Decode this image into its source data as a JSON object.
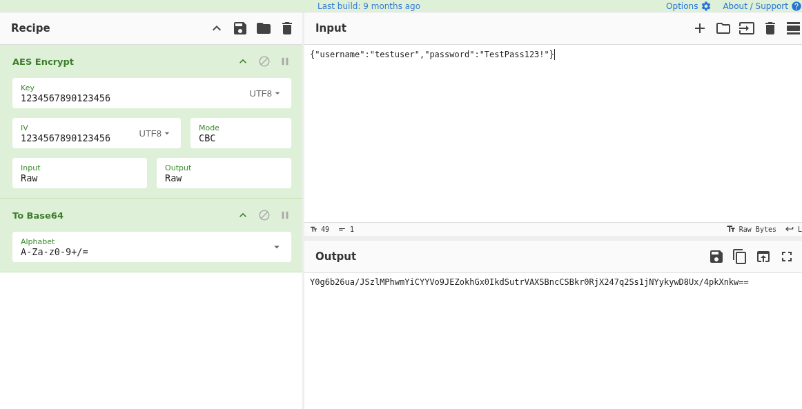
{
  "banner": {
    "build": "Last build: 9 months ago",
    "links": [
      {
        "label": "Options",
        "kind": "settings"
      },
      {
        "label": "About / Support",
        "kind": "help"
      }
    ]
  },
  "recipe": {
    "title": "Recipe",
    "operations": [
      {
        "name": "AES Encrypt",
        "rows": [
          [
            {
              "label": "Key",
              "value": "1234567890123456",
              "encoding": "UTF8"
            }
          ],
          [
            {
              "label": "IV",
              "value": "1234567890123456",
              "encoding": "UTF8"
            },
            {
              "label": "Mode",
              "value": "CBC"
            }
          ],
          [
            {
              "label": "Input",
              "value": "Raw"
            },
            {
              "label": "Output",
              "value": "Raw"
            }
          ]
        ]
      },
      {
        "name": "To Base64",
        "rows": [
          [
            {
              "label": "Alphabet",
              "value": "A-Za-z0-9+/=",
              "dropdown": true
            }
          ]
        ]
      }
    ]
  },
  "input": {
    "title": "Input",
    "text": "{\"username\":\"testuser\",\"password\":\"TestPass123!\"}",
    "stats": [
      {
        "kind": "chars",
        "value": "49"
      },
      {
        "kind": "lines",
        "value": "1"
      }
    ],
    "format": "Raw Bytes",
    "eol": "L"
  },
  "output": {
    "title": "Output",
    "text": "Y0g6b26ua/JSzlMPhwmYiCYYVo9JEZokhGx0IkdSutrVAXSBncCSBkr0RjX247q2Ss1jNYykywD8Ux/4pkXnkw=="
  }
}
